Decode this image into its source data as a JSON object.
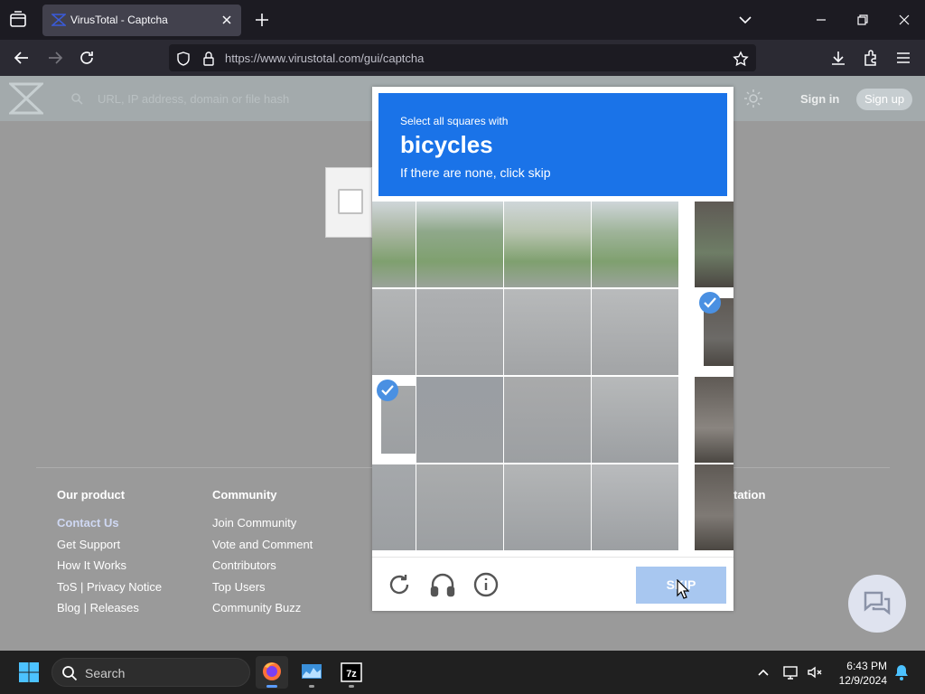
{
  "browser": {
    "tab_title": "VirusTotal - Captcha",
    "url": "https://www.virustotal.com/gui/captcha"
  },
  "virustotal": {
    "search_placeholder": "URL, IP address, domain or file hash",
    "sign_in": "Sign in",
    "sign_up": "Sign up"
  },
  "footer": {
    "columns": [
      {
        "heading": "Our product",
        "links": [
          "Contact Us",
          "Get Support",
          "How It Works",
          "ToS | Privacy Notice",
          "Blog | Releases"
        ]
      },
      {
        "heading": "Community",
        "links": [
          "Join Community",
          "Vote and Comment",
          "Contributors",
          "Top Users",
          "Community Buzz"
        ]
      }
    ],
    "partial_heading_right": "tation"
  },
  "captcha": {
    "instruction": "Select all squares with",
    "target": "bicycles",
    "hint": "If there are none, click skip",
    "skip_label": "SKIP",
    "selected_tiles": [
      9,
      10
    ]
  },
  "taskbar": {
    "search_label": "Search",
    "time": "6:43 PM",
    "date": "12/9/2024"
  },
  "colors": {
    "captcha_header": "#1a73e8",
    "skip_button": "#a8c7f0",
    "check": "#4a90e2"
  }
}
